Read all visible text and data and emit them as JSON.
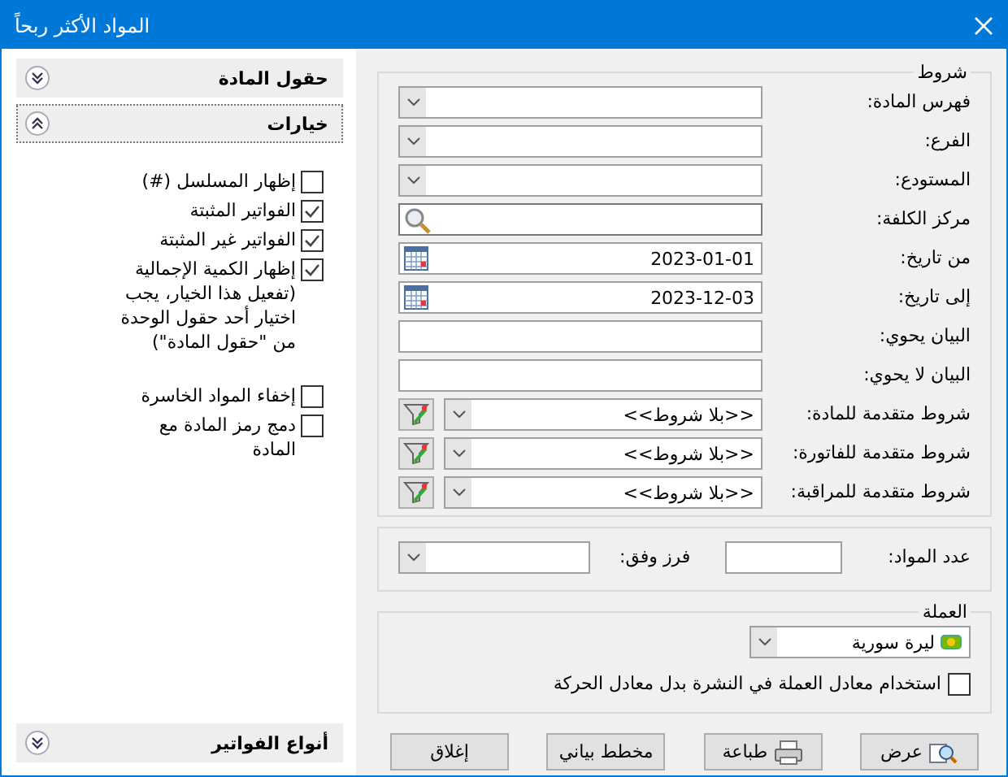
{
  "window": {
    "title": "المواد الأكثر ربحاً"
  },
  "sidebar": {
    "sections": [
      {
        "title": "حقول المادة",
        "expanded": false
      },
      {
        "title": "خيارات",
        "expanded": true,
        "option_groups": [
          [
            {
              "label": "إظهار المسلسل (#)",
              "checked": false
            },
            {
              "label": "الفواتير المثبتة",
              "checked": true
            },
            {
              "label": "الفواتير غير المثبتة",
              "checked": true
            },
            {
              "label": "إظهار الكمية الإجمالية (تفعيل هذا الخيار، يجب اختيار أحد حقول الوحدة من \"حقول المادة\")",
              "checked": true
            }
          ],
          [
            {
              "label": "إخفاء المواد الخاسرة",
              "checked": false
            },
            {
              "label": "دمج رمز المادة مع المادة",
              "checked": false
            }
          ]
        ]
      }
    ],
    "footer_section": {
      "title": "أنواع الفواتير",
      "expanded": false
    }
  },
  "conditions": {
    "title": "شروط",
    "rows": [
      {
        "kind": "combo",
        "label": "فهرس المادة:"
      },
      {
        "kind": "combo",
        "label": "الفرع:"
      },
      {
        "kind": "combo",
        "label": "المستودع:"
      },
      {
        "kind": "search",
        "label": "مركز الكلفة:"
      },
      {
        "kind": "date",
        "label": "من تاريخ:",
        "value": "2023-01-01"
      },
      {
        "kind": "date",
        "label": "إلى تاريخ:",
        "value": "2023-12-03"
      },
      {
        "kind": "text",
        "label": "البيان يحوي:"
      },
      {
        "kind": "text",
        "label": "البيان لا يحوي:"
      },
      {
        "kind": "advanced",
        "label": "شروط متقدمة للمادة:",
        "value": "<<بلا شروط>>"
      },
      {
        "kind": "advanced",
        "label": "شروط متقدمة للفاتورة:",
        "value": "<<بلا شروط>>"
      },
      {
        "kind": "advanced",
        "label": "شروط متقدمة للمراقبة:",
        "value": "<<بلا شروط>>"
      }
    ]
  },
  "count": {
    "label": "عدد المواد:",
    "sort_label": "فرز وفق:"
  },
  "currency": {
    "title": "العملة",
    "value": "ليرة سورية",
    "option": {
      "label": "استخدام معادل العملة في النشرة بدل معادل الحركة",
      "checked": false
    }
  },
  "buttons": [
    {
      "kind": "view",
      "label": "عرض"
    },
    {
      "kind": "print",
      "label": "طباعة"
    },
    {
      "kind": "chart",
      "label": "مخطط بياني"
    },
    {
      "kind": "close",
      "label": "إغلاق"
    }
  ]
}
